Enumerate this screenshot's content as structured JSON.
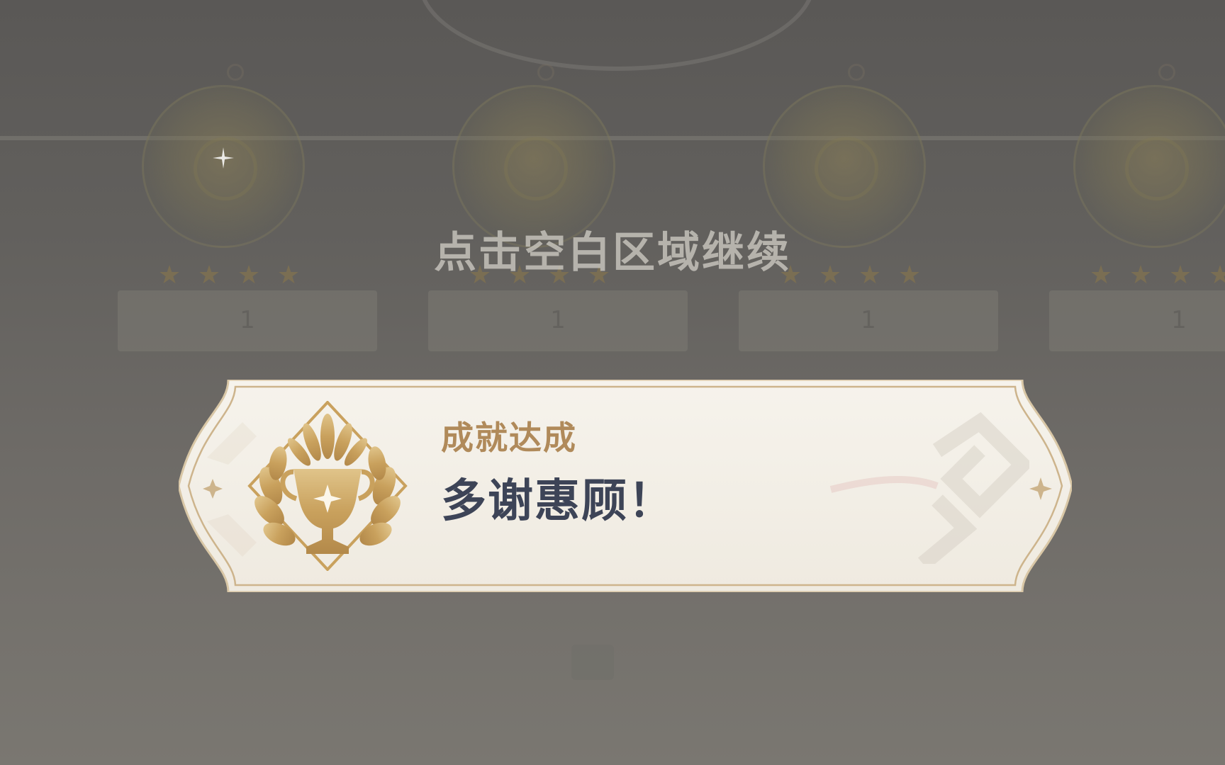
{
  "continue_prompt": "点击空白区域继续",
  "reward_cards": [
    {
      "count": "1",
      "stars": 4
    },
    {
      "count": "1",
      "stars": 4
    },
    {
      "count": "1",
      "stars": 4
    },
    {
      "count": "1",
      "stars": 4
    }
  ],
  "achievement": {
    "label": "成就达成",
    "title": "多谢惠顾！",
    "icon": "trophy-laurel-icon"
  },
  "colors": {
    "label": "#b08a5a",
    "title": "#3d4457",
    "banner_bg": "#f4f1ea",
    "banner_border": "#cdb48c",
    "badge_gold": "#c9a15d"
  }
}
